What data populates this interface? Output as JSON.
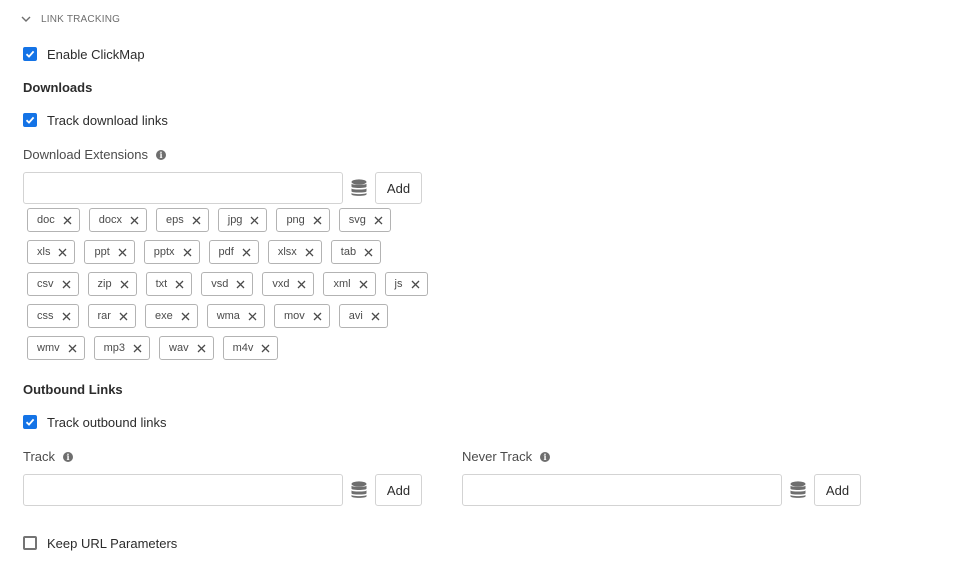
{
  "section": {
    "title": "LINK TRACKING"
  },
  "clickmap": {
    "label": "Enable ClickMap",
    "checked": true
  },
  "downloads": {
    "heading": "Downloads",
    "track": {
      "label": "Track download links",
      "checked": true
    },
    "extensions_label": "Download Extensions",
    "add_label": "Add",
    "input_value": "",
    "extensions": [
      [
        "doc",
        "docx",
        "eps",
        "jpg",
        "png",
        "svg"
      ],
      [
        "xls",
        "ppt",
        "pptx",
        "pdf",
        "xlsx",
        "tab"
      ],
      [
        "csv",
        "zip",
        "txt",
        "vsd",
        "vxd",
        "xml",
        "js"
      ],
      [
        "css",
        "rar",
        "exe",
        "wma",
        "mov",
        "avi"
      ],
      [
        "wmv",
        "mp3",
        "wav",
        "m4v"
      ]
    ]
  },
  "outbound": {
    "heading": "Outbound Links",
    "track": {
      "label": "Track outbound links",
      "checked": true
    },
    "track_field": {
      "label": "Track",
      "add_label": "Add",
      "value": ""
    },
    "never_track_field": {
      "label": "Never Track",
      "add_label": "Add",
      "value": ""
    }
  },
  "keep_url": {
    "label": "Keep URL Parameters",
    "checked": false
  },
  "colors": {
    "accent": "#1473e6",
    "border": "#d3d3d3",
    "tag_border": "#b3b3b3"
  },
  "icons": {
    "chevron": "chevron-down-icon",
    "info": "info-icon",
    "data_element": "database-icon",
    "remove": "close-icon"
  }
}
